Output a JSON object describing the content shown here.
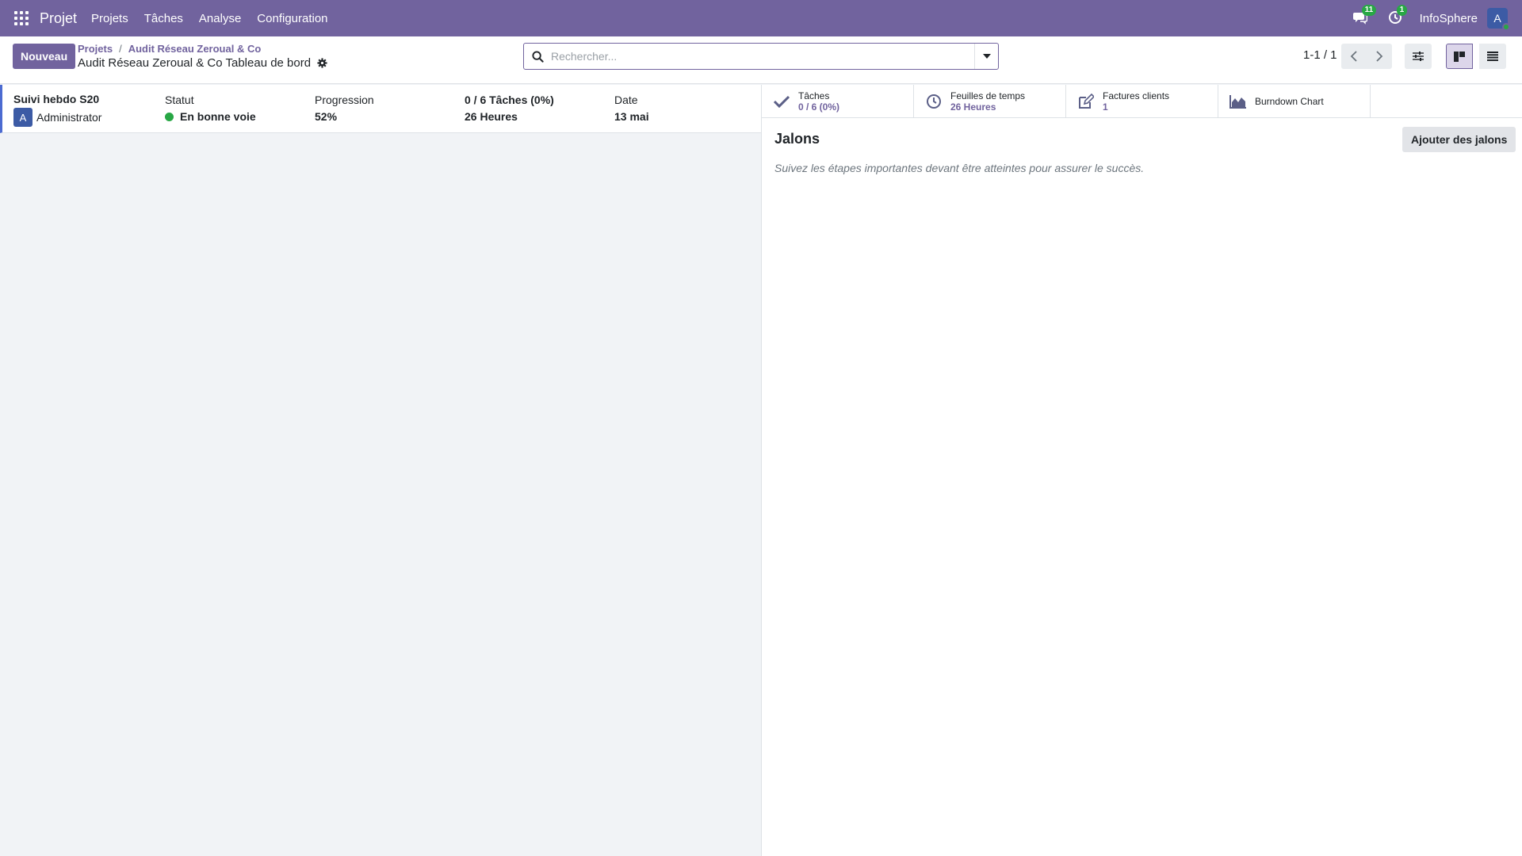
{
  "navbar": {
    "app_name": "Projet",
    "menu": [
      "Projets",
      "Tâches",
      "Analyse",
      "Configuration"
    ],
    "messages_count": "11",
    "activities_count": "1",
    "company": "InfoSphere",
    "user_initial": "A",
    "color": "#71639e"
  },
  "control": {
    "new_label": "Nouveau",
    "breadcrumb": [
      "Projets",
      "Audit Réseau Zeroual & Co"
    ],
    "page_title": "Audit Réseau Zeroual & Co Tableau de bord",
    "search_placeholder": "Rechercher...",
    "pager": "1-1 / 1"
  },
  "update": {
    "title": "Suivi hebdo S20",
    "user_initial": "A",
    "user_name": "Administrator",
    "status_label": "Statut",
    "status_value": "En bonne voie",
    "status_color": "#28a745",
    "progress_label": "Progression",
    "progress_value": "52%",
    "tasks_value": "0 / 6 Tâches (0%)",
    "hours_value": "26 Heures",
    "date_label": "Date",
    "date_value": "13 mai"
  },
  "stats": [
    {
      "label": "Tâches",
      "value": "0 / 6 (0%)"
    },
    {
      "label": "Feuilles de temps",
      "value": "26 Heures"
    },
    {
      "label": "Factures clients",
      "value": "1"
    },
    {
      "label": "Burndown Chart",
      "value": ""
    }
  ],
  "milestones": {
    "title": "Jalons",
    "add_label": "Ajouter des jalons",
    "help": "Suivez les étapes importantes devant être atteintes pour assurer le succès."
  }
}
